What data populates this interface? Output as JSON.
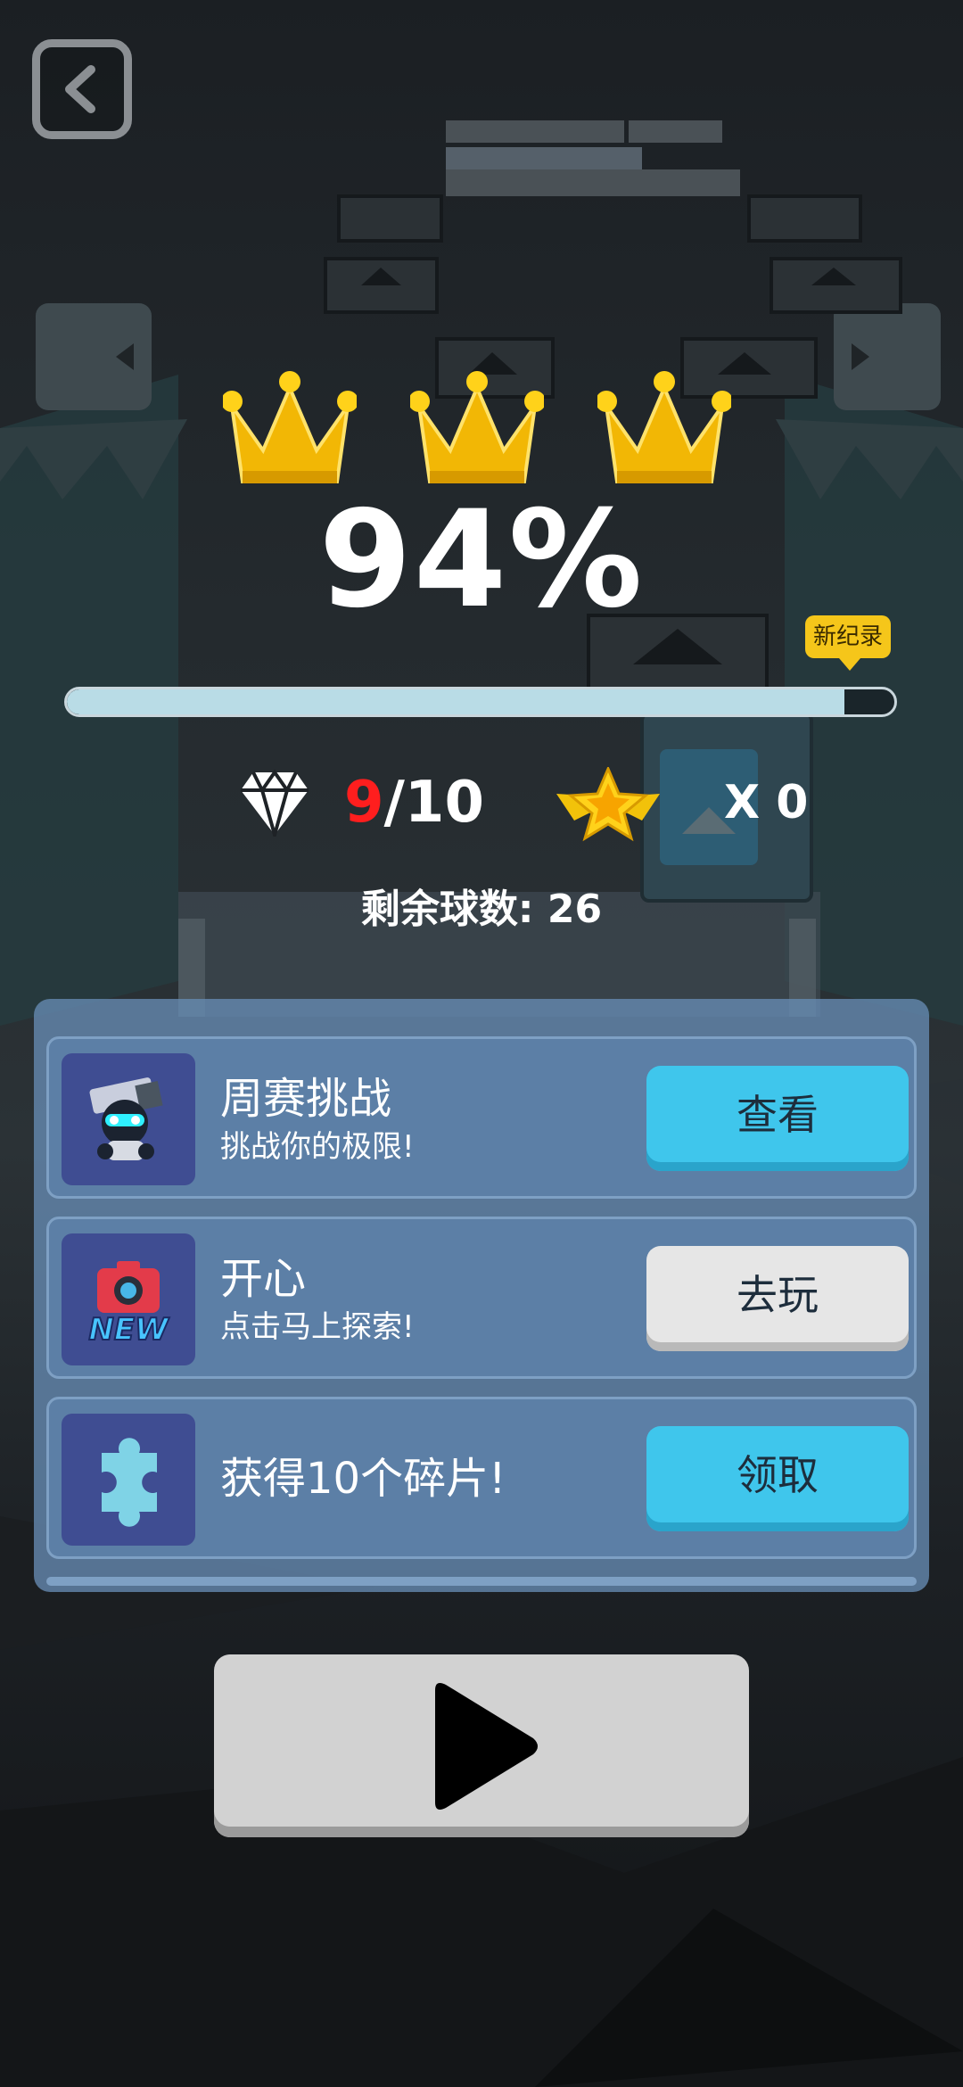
{
  "header": {
    "back_icon": "chevron-left-icon"
  },
  "result": {
    "crowns_earned": 3,
    "crowns_total": 3,
    "percent_text": "94%",
    "progress": 0.94,
    "record_badge": "新纪录"
  },
  "stats": {
    "gems_current": "9",
    "gems_total": "/10",
    "stars_text": "X 0",
    "balls_left": "剩余球数: 26"
  },
  "cards": [
    {
      "title": "周赛挑战",
      "subtitle": "挑战你的极限!",
      "button": "查看",
      "icon": "robot-icon"
    },
    {
      "title": "开心",
      "subtitle": "点击马上探索!",
      "button": "去玩",
      "icon": "new-game-icon",
      "badge": "NEW"
    },
    {
      "title": "获得10个碎片!",
      "subtitle": "",
      "button": "领取",
      "icon": "puzzle-piece-icon"
    }
  ],
  "play": {
    "icon": "play-icon"
  },
  "colors": {
    "accent_blue": "#3fc6ec",
    "gold": "#f5c61a",
    "gem_red": "#ff1e1e"
  }
}
